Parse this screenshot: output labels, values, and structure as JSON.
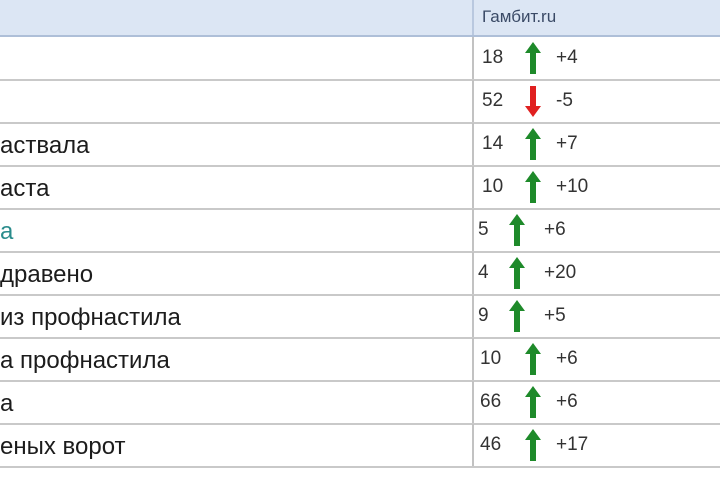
{
  "header": {
    "column_label": "Гамбит.ru"
  },
  "rows": [
    {
      "name": "",
      "position": "18",
      "direction": "up",
      "change": "+4"
    },
    {
      "name": "",
      "position": "52",
      "direction": "down",
      "change": "-5"
    },
    {
      "name": "аствала",
      "position": "14",
      "direction": "up",
      "change": "+7"
    },
    {
      "name": "аста",
      "position": "10",
      "direction": "up",
      "change": "+10"
    },
    {
      "name": "a",
      "position": "5",
      "direction": "up",
      "change": "+6",
      "teal": true
    },
    {
      "name": "дравено",
      "position": "4",
      "direction": "up",
      "change": "+20"
    },
    {
      "name": "из профнастила",
      "position": "9",
      "direction": "up",
      "change": "+5"
    },
    {
      "name": "а профнастила",
      "position": "10",
      "direction": "up",
      "change": "+6"
    },
    {
      "name": "а",
      "position": "66",
      "direction": "up",
      "change": "+6"
    },
    {
      "name": "еных ворот",
      "position": "46",
      "direction": "up",
      "change": "+17"
    }
  ],
  "colors": {
    "up": "#1e8a2a",
    "down": "#e02020",
    "header_bg": "#dce6f4"
  }
}
